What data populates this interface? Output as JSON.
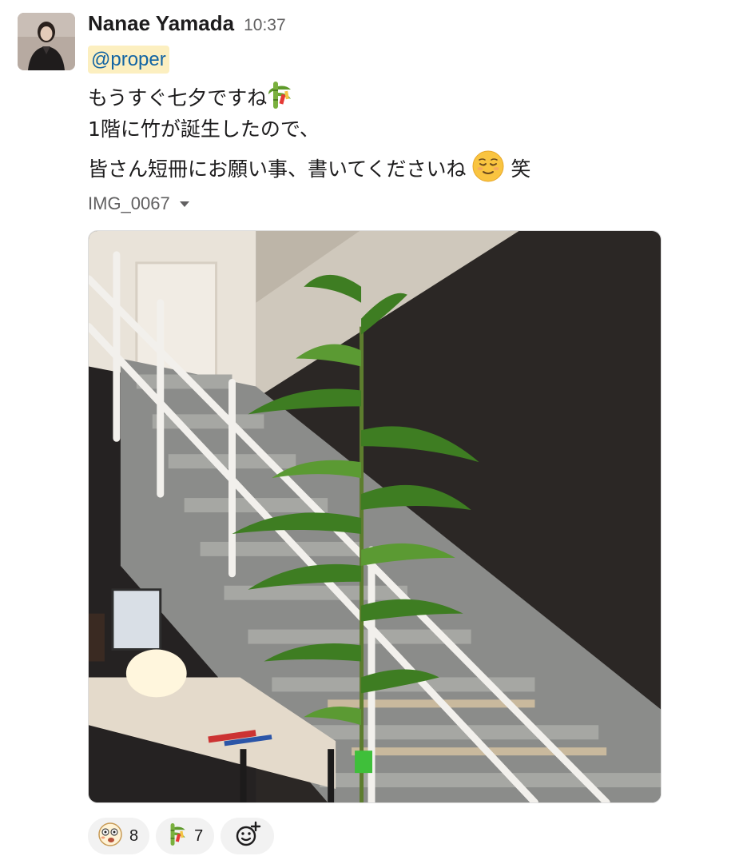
{
  "message": {
    "sender": "Nanae Yamada",
    "time": "10:37",
    "mention": "@proper",
    "lines": [
      "もうすぐ七夕ですね",
      "1階に竹が誕生したので、",
      "皆さん短冊にお願い事、書いてくださいね",
      "笑"
    ]
  },
  "attachment": {
    "name": "IMG_0067"
  },
  "reactions": [
    {
      "emoji": "surprised-face-icon",
      "count": "8"
    },
    {
      "emoji": "tanabata-tree-icon",
      "count": "7"
    }
  ],
  "icons": {
    "line1_emoji": "tanabata-tree-icon",
    "line3_emoji": "relieved-face-icon",
    "add_reaction": "add-reaction-icon",
    "attachment_caret": "chevron-down-icon"
  },
  "colors": {
    "mention_bg": "#fcefc0",
    "mention_text": "#1264a3",
    "reaction_bg": "#f2f2f2"
  }
}
